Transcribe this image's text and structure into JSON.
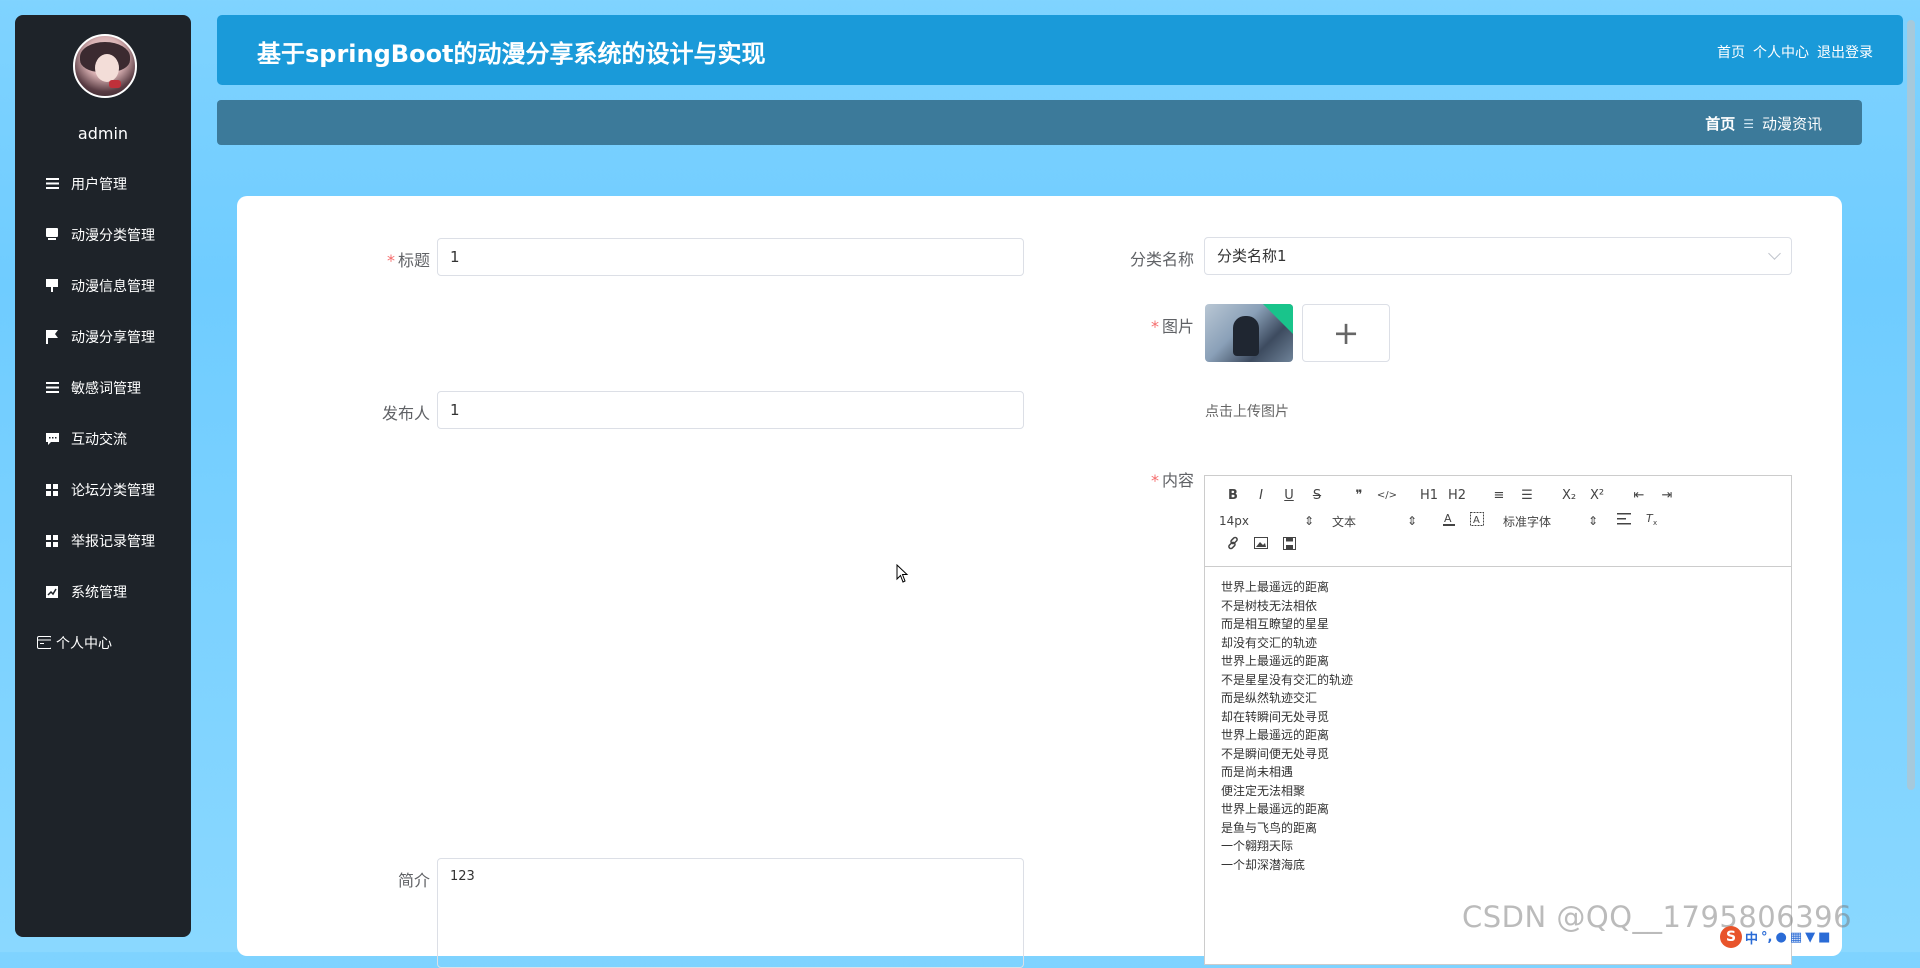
{
  "user": {
    "name": "admin"
  },
  "sidebar": {
    "items": [
      {
        "label": "用户管理",
        "icon": "list-icon"
      },
      {
        "label": "动漫分类管理",
        "icon": "monitor-icon"
      },
      {
        "label": "动漫信息管理",
        "icon": "billboard-icon"
      },
      {
        "label": "动漫分享管理",
        "icon": "flag-icon"
      },
      {
        "label": "敏感词管理",
        "icon": "list-icon"
      },
      {
        "label": "互动交流",
        "icon": "chat-icon"
      },
      {
        "label": "论坛分类管理",
        "icon": "grid-icon"
      },
      {
        "label": "举报记录管理",
        "icon": "grid-icon"
      },
      {
        "label": "系统管理",
        "icon": "chart-icon"
      },
      {
        "label": "个人中心",
        "icon": "card-icon"
      }
    ]
  },
  "header": {
    "title": "基于springBoot的动漫分享系统的设计与实现",
    "links": [
      "首页",
      "个人中心",
      "退出登录"
    ]
  },
  "breadcrumb": {
    "home": "首页",
    "separator": "☰",
    "current": "动漫资讯"
  },
  "form": {
    "title": {
      "label": "标题",
      "value": "1",
      "required": "*"
    },
    "publisher": {
      "label": "发布人",
      "value": "1"
    },
    "summary": {
      "label": "简介",
      "value": "123"
    },
    "category": {
      "label": "分类名称",
      "value": "分类名称1"
    },
    "image": {
      "label": "图片",
      "required": "*",
      "upload_tip": "点击上传图片",
      "add": "+"
    },
    "content": {
      "label": "内容",
      "required": "*"
    }
  },
  "editor": {
    "toolbar": {
      "row1": [
        "B",
        "I",
        "U",
        "S",
        "❞",
        "</>",
        "H1",
        "H2",
        "≡",
        "☰",
        "X₂",
        "X²",
        "⇤",
        "⇥"
      ],
      "font_size": "14px",
      "text_type": "文本",
      "font_family": "标准字体"
    },
    "lines": [
      "世界上最遥远的距离",
      "不是树枝无法相依",
      "而是相互瞭望的星星",
      "却没有交汇的轨迹",
      "世界上最遥远的距离",
      "不是星星没有交汇的轨迹",
      "而是纵然轨迹交汇",
      "却在转瞬间无处寻觅",
      "世界上最遥远的距离",
      "不是瞬间便无处寻觅",
      "而是尚未相遇",
      "便注定无法相聚",
      "世界上最遥远的距离",
      "是鱼与飞鸟的距离",
      "一个翱翔天际",
      "一个却深潜海底"
    ]
  },
  "watermark": "CSDN @QQ__1795806396",
  "ime": {
    "logo": "S",
    "lang": "中"
  }
}
